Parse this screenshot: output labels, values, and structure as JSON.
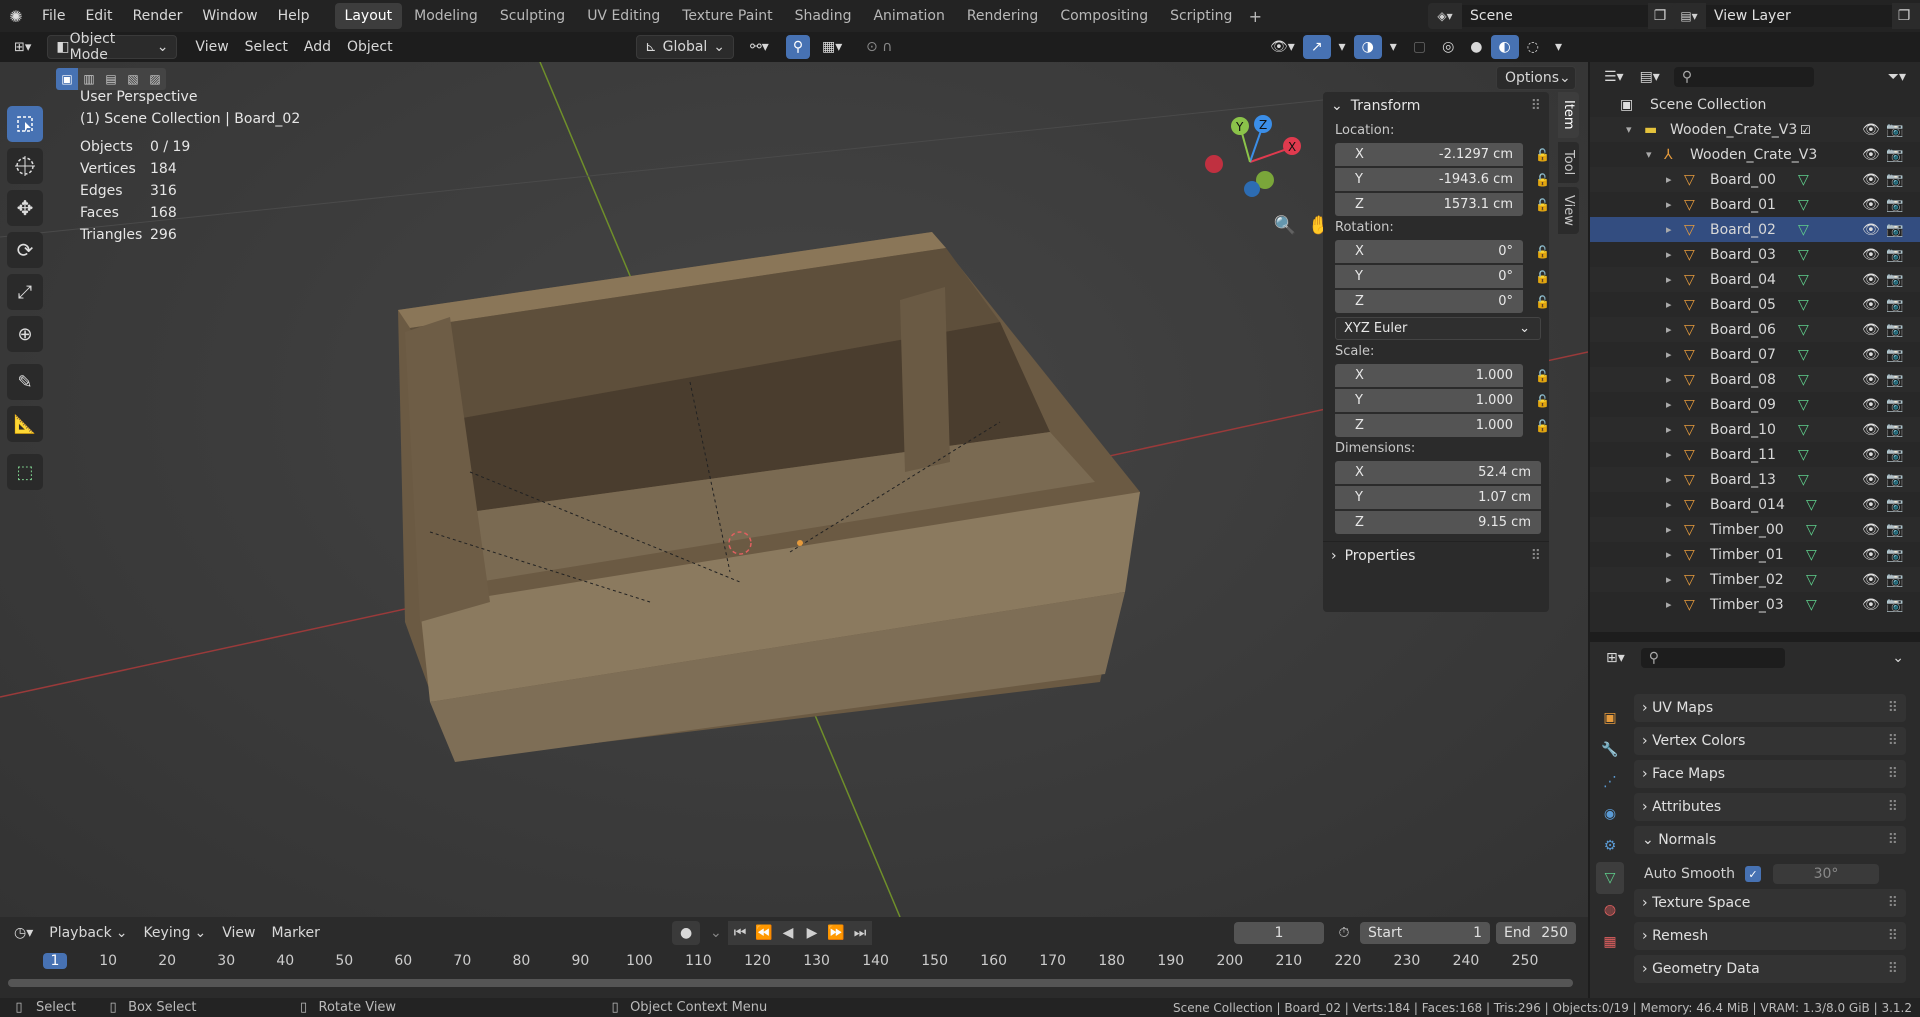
{
  "topbar": {
    "menus": [
      "File",
      "Edit",
      "Render",
      "Window",
      "Help"
    ],
    "workspaces": [
      "Layout",
      "Modeling",
      "Sculpting",
      "UV Editing",
      "Texture Paint",
      "Shading",
      "Animation",
      "Rendering",
      "Compositing",
      "Scripting"
    ],
    "active_workspace": "Layout",
    "scene": "Scene",
    "view_layer": "View Layer"
  },
  "vpheader": {
    "mode": "Object Mode",
    "menus": [
      "View",
      "Select",
      "Add",
      "Object"
    ],
    "orientation": "Global",
    "options": "Options"
  },
  "viewport": {
    "perspective": "User Perspective",
    "context": "(1) Scene Collection | Board_02",
    "stats": [
      {
        "label": "Objects",
        "value": "0 / 19"
      },
      {
        "label": "Vertices",
        "value": "184"
      },
      {
        "label": "Edges",
        "value": "316"
      },
      {
        "label": "Faces",
        "value": "168"
      },
      {
        "label": "Triangles",
        "value": "296"
      }
    ],
    "gizmo": {
      "x": "X",
      "y": "Y",
      "z": "Z"
    }
  },
  "npanel": {
    "tabs": [
      "Item",
      "Tool",
      "View"
    ],
    "transform": "Transform",
    "location_label": "Location:",
    "location": [
      {
        "axis": "X",
        "value": "-2.1297 cm"
      },
      {
        "axis": "Y",
        "value": "-1943.6 cm"
      },
      {
        "axis": "Z",
        "value": "1573.1 cm"
      }
    ],
    "rotation_label": "Rotation:",
    "rotation": [
      {
        "axis": "X",
        "value": "0°"
      },
      {
        "axis": "Y",
        "value": "0°"
      },
      {
        "axis": "Z",
        "value": "0°"
      }
    ],
    "rotation_mode": "XYZ Euler",
    "scale_label": "Scale:",
    "scale": [
      {
        "axis": "X",
        "value": "1.000"
      },
      {
        "axis": "Y",
        "value": "1.000"
      },
      {
        "axis": "Z",
        "value": "1.000"
      }
    ],
    "dimensions_label": "Dimensions:",
    "dimensions": [
      {
        "axis": "X",
        "value": "52.4 cm"
      },
      {
        "axis": "Y",
        "value": "1.07 cm"
      },
      {
        "axis": "Z",
        "value": "9.15 cm"
      }
    ],
    "properties": "Properties"
  },
  "outliner": {
    "root": "Scene Collection",
    "collection": "Wooden_Crate_V3",
    "empty": "Wooden_Crate_V3",
    "items": [
      "Board_00",
      "Board_01",
      "Board_02",
      "Board_03",
      "Board_04",
      "Board_05",
      "Board_06",
      "Board_07",
      "Board_08",
      "Board_09",
      "Board_10",
      "Board_11",
      "Board_13",
      "Board_014",
      "Timber_00",
      "Timber_01",
      "Timber_02",
      "Timber_03"
    ]
  },
  "props": {
    "sections": [
      "UV Maps",
      "Vertex Colors",
      "Face Maps",
      "Attributes"
    ],
    "normals": "Normals",
    "auto_smooth": "Auto Smooth",
    "angle": "30°",
    "sections2": [
      "Texture Space",
      "Remesh",
      "Geometry Data"
    ]
  },
  "timeline": {
    "menus": [
      "Playback",
      "Keying",
      "View",
      "Marker"
    ],
    "current_frame": "1",
    "start_label": "Start",
    "start": "1",
    "end_label": "End",
    "end": "250",
    "ruler": [
      "1",
      "10",
      "20",
      "30",
      "40",
      "50",
      "60",
      "70",
      "80",
      "90",
      "100",
      "110",
      "120",
      "130",
      "140",
      "150",
      "160",
      "170",
      "180",
      "190",
      "200",
      "210",
      "220",
      "230",
      "240",
      "250"
    ]
  },
  "statusbar": {
    "select": "Select",
    "box_select": "Box Select",
    "rotate": "Rotate View",
    "context_menu": "Object Context Menu",
    "info": "Scene Collection | Board_02 | Verts:184 | Faces:168 | Tris:296 | Objects:0/19 | Memory: 46.4 MiB | VRAM: 1.3/8.0 GiB | 3.1.2"
  },
  "colors": {
    "accent": "#4772b3",
    "x_axis": "#e03a4e",
    "y_axis": "#8bc34a",
    "z_axis": "#3b8ee8",
    "object_orange": "#e59a3c",
    "mesh_green": "#5fcf8c"
  }
}
